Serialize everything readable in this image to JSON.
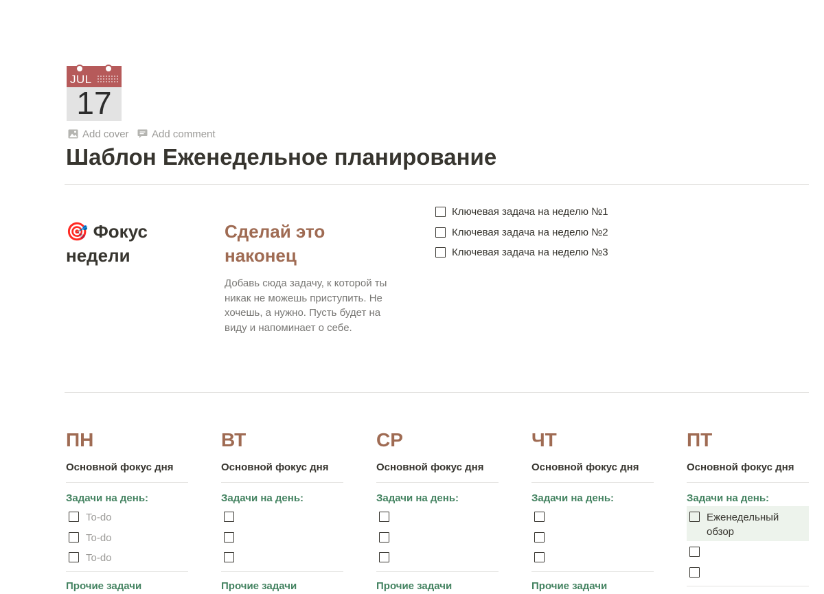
{
  "page": {
    "icon": {
      "name": "calendar-icon",
      "month": "JUL",
      "day": "17"
    },
    "add_cover": "Add cover",
    "add_comment": "Add comment",
    "title": "Шаблон Еженедельное планирование"
  },
  "focus_section": {
    "emoji": "🎯",
    "heading": "Фокус недели",
    "do_it_heading": "Сделай это наконец",
    "do_it_description": "Добавь сюда задачу, к которой ты никак не можешь приступить. Не хочешь, а нужно. Пусть будет на виду и напоминает о себе.",
    "key_tasks": [
      "Ключевая задача на неделю №1",
      "Ключевая задача на неделю №2",
      "Ключевая задача на неделю №3"
    ]
  },
  "days": [
    {
      "name": "ПН",
      "focus_label": "Основной фокус дня",
      "tasks_label": "Задачи на день:",
      "todos": [
        {
          "text": "To-do",
          "placeholder": true
        },
        {
          "text": "To-do",
          "placeholder": true
        },
        {
          "text": "To-do",
          "placeholder": true
        }
      ],
      "other_label": "Прочие задачи"
    },
    {
      "name": "ВТ",
      "focus_label": "Основной фокус дня",
      "tasks_label": "Задачи на день:",
      "todos": [
        {
          "text": ""
        },
        {
          "text": ""
        },
        {
          "text": ""
        }
      ],
      "other_label": "Прочие задачи"
    },
    {
      "name": "СР",
      "focus_label": "Основной фокус дня",
      "tasks_label": "Задачи на день:",
      "todos": [
        {
          "text": ""
        },
        {
          "text": ""
        },
        {
          "text": ""
        }
      ],
      "other_label": "Прочие задачи"
    },
    {
      "name": "ЧТ",
      "focus_label": "Основной фокус дня",
      "tasks_label": "Задачи на день:",
      "todos": [
        {
          "text": ""
        },
        {
          "text": ""
        },
        {
          "text": ""
        }
      ],
      "other_label": "Прочие задачи"
    },
    {
      "name": "ПТ",
      "focus_label": "Основной фокус дня",
      "tasks_label": "Задачи на день:",
      "todos": [
        {
          "text": "Еженедельный обзор",
          "highlight": true
        },
        {
          "text": ""
        },
        {
          "text": ""
        }
      ],
      "other_label": ""
    }
  ],
  "colors": {
    "heading_brown": "#9f6b53",
    "heading_green": "#448361",
    "highlight_bg": "#edf3ec",
    "calendar_red": "#b65a5a"
  }
}
